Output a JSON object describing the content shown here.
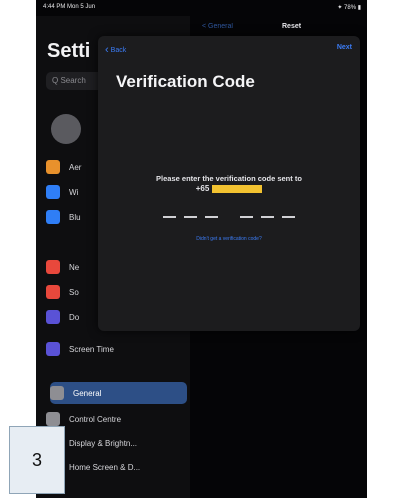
{
  "status_bar": {
    "time": "4:44 PM  Mon 5 Jun",
    "right": "✦ 78% ▮"
  },
  "sidebar": {
    "title": "Setti",
    "search_placeholder": "Q Search",
    "items": [
      {
        "label": "Aer",
        "color": "#e8912c"
      },
      {
        "label": "Wi",
        "color": "#2f7ef6"
      },
      {
        "label": "Blu",
        "color": "#2f7ef6"
      },
      {
        "label": "Ne",
        "color": "#e8483c"
      },
      {
        "label": "So",
        "color": "#e8483c"
      },
      {
        "label": "Do",
        "color": "#5a52d6"
      },
      {
        "label": "Screen Time",
        "color": "#5a52d6"
      },
      {
        "label": "General",
        "color": "#8e8e93"
      },
      {
        "label": "Control Centre",
        "color": "#8e8e93"
      },
      {
        "label": "Display & Brightn...",
        "color": "#2f7ef6"
      },
      {
        "label": "Home Screen & D...",
        "color": "#2f7ef6"
      }
    ]
  },
  "detail": {
    "back": "< General",
    "title": "Reset"
  },
  "modal": {
    "back_label": "Back",
    "next_label": "Next",
    "title": "Verification Code",
    "prompt": "Please enter the verification code sent to",
    "phone_prefix": "+65",
    "link": "Didn't get a verification code?"
  },
  "step": {
    "number": "3"
  }
}
